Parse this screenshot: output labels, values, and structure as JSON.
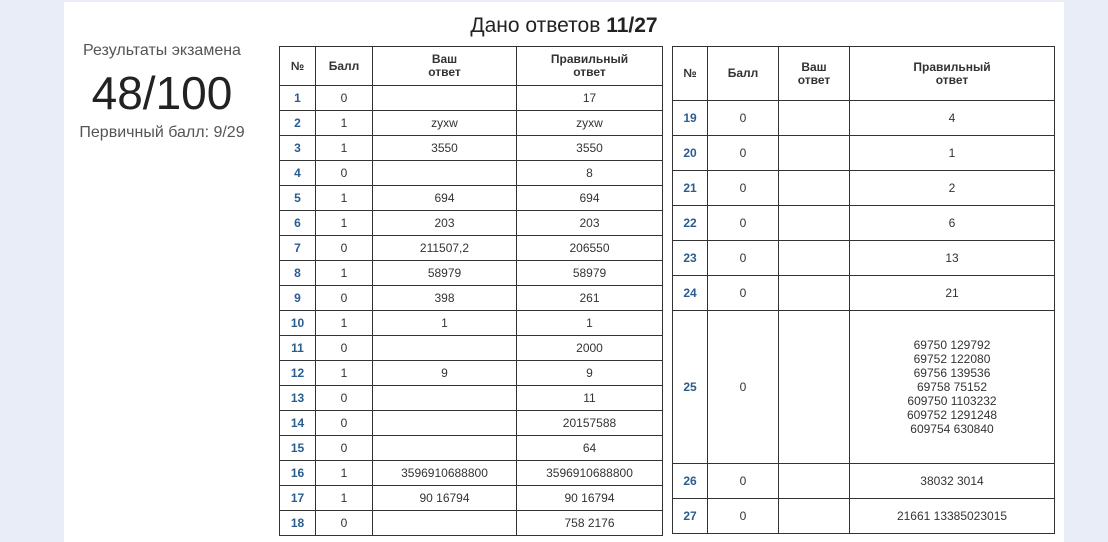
{
  "header": {
    "answered_label": "Дано ответов",
    "answered_value": "11/27"
  },
  "results": {
    "title": "Результаты экзамена",
    "score": "48/100",
    "primary": "Первичный балл: 9/29"
  },
  "table_headers": {
    "num": "№",
    "points": "Балл",
    "your_answer_line1": "Ваш",
    "your_answer_line2": "ответ",
    "correct_line1": "Правильный",
    "correct_line2": "ответ"
  },
  "left_rows": [
    {
      "num": "1",
      "points": "0",
      "yours": "",
      "correct": "17"
    },
    {
      "num": "2",
      "points": "1",
      "yours": "zyxw",
      "correct": "zyxw"
    },
    {
      "num": "3",
      "points": "1",
      "yours": "3550",
      "correct": "3550"
    },
    {
      "num": "4",
      "points": "0",
      "yours": "",
      "correct": "8"
    },
    {
      "num": "5",
      "points": "1",
      "yours": "694",
      "correct": "694"
    },
    {
      "num": "6",
      "points": "1",
      "yours": "203",
      "correct": "203"
    },
    {
      "num": "7",
      "points": "0",
      "yours": "211507,2",
      "correct": "206550"
    },
    {
      "num": "8",
      "points": "1",
      "yours": "58979",
      "correct": "58979"
    },
    {
      "num": "9",
      "points": "0",
      "yours": "398",
      "correct": "261"
    },
    {
      "num": "10",
      "points": "1",
      "yours": "1",
      "correct": "1"
    },
    {
      "num": "11",
      "points": "0",
      "yours": "",
      "correct": "2000"
    },
    {
      "num": "12",
      "points": "1",
      "yours": "9",
      "correct": "9"
    },
    {
      "num": "13",
      "points": "0",
      "yours": "",
      "correct": "11"
    },
    {
      "num": "14",
      "points": "0",
      "yours": "",
      "correct": "20157588"
    },
    {
      "num": "15",
      "points": "0",
      "yours": "",
      "correct": "64"
    },
    {
      "num": "16",
      "points": "1",
      "yours": "3596910688800",
      "correct": "3596910688800"
    },
    {
      "num": "17",
      "points": "1",
      "yours": "90 16794",
      "correct": "90 16794"
    },
    {
      "num": "18",
      "points": "0",
      "yours": "",
      "correct": "758 2176"
    }
  ],
  "right_rows": [
    {
      "num": "19",
      "points": "0",
      "yours": "",
      "correct": "4"
    },
    {
      "num": "20",
      "points": "0",
      "yours": "",
      "correct": "1"
    },
    {
      "num": "21",
      "points": "0",
      "yours": "",
      "correct": "2"
    },
    {
      "num": "22",
      "points": "0",
      "yours": "",
      "correct": "6"
    },
    {
      "num": "23",
      "points": "0",
      "yours": "",
      "correct": "13"
    },
    {
      "num": "24",
      "points": "0",
      "yours": "",
      "correct": "21"
    },
    {
      "num": "25",
      "points": "0",
      "yours": "",
      "correct_lines": [
        "69750 129792",
        "69752 122080",
        "69756 139536",
        "69758 75152",
        "609750 1103232",
        "609752 1291248",
        "609754 630840"
      ]
    },
    {
      "num": "26",
      "points": "0",
      "yours": "",
      "correct": "38032 3014"
    },
    {
      "num": "27",
      "points": "0",
      "yours": "",
      "correct": "21661 13385023015"
    }
  ]
}
